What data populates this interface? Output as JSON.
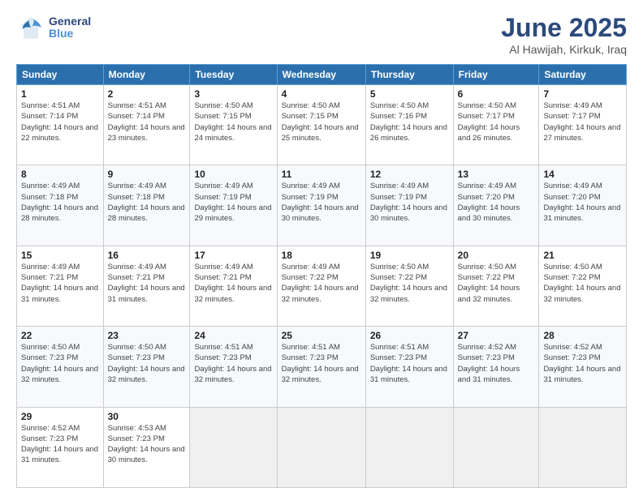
{
  "header": {
    "logo_general": "General",
    "logo_blue": "Blue",
    "month_title": "June 2025",
    "location": "Al Hawijah, Kirkuk, Iraq"
  },
  "weekdays": [
    "Sunday",
    "Monday",
    "Tuesday",
    "Wednesday",
    "Thursday",
    "Friday",
    "Saturday"
  ],
  "weeks": [
    [
      {
        "day": "1",
        "sunrise": "4:51 AM",
        "sunset": "7:14 PM",
        "daylight": "14 hours and 22 minutes."
      },
      {
        "day": "2",
        "sunrise": "4:51 AM",
        "sunset": "7:14 PM",
        "daylight": "14 hours and 23 minutes."
      },
      {
        "day": "3",
        "sunrise": "4:50 AM",
        "sunset": "7:15 PM",
        "daylight": "14 hours and 24 minutes."
      },
      {
        "day": "4",
        "sunrise": "4:50 AM",
        "sunset": "7:15 PM",
        "daylight": "14 hours and 25 minutes."
      },
      {
        "day": "5",
        "sunrise": "4:50 AM",
        "sunset": "7:16 PM",
        "daylight": "14 hours and 26 minutes."
      },
      {
        "day": "6",
        "sunrise": "4:50 AM",
        "sunset": "7:17 PM",
        "daylight": "14 hours and 26 minutes."
      },
      {
        "day": "7",
        "sunrise": "4:49 AM",
        "sunset": "7:17 PM",
        "daylight": "14 hours and 27 minutes."
      }
    ],
    [
      {
        "day": "8",
        "sunrise": "4:49 AM",
        "sunset": "7:18 PM",
        "daylight": "14 hours and 28 minutes."
      },
      {
        "day": "9",
        "sunrise": "4:49 AM",
        "sunset": "7:18 PM",
        "daylight": "14 hours and 28 minutes."
      },
      {
        "day": "10",
        "sunrise": "4:49 AM",
        "sunset": "7:19 PM",
        "daylight": "14 hours and 29 minutes."
      },
      {
        "day": "11",
        "sunrise": "4:49 AM",
        "sunset": "7:19 PM",
        "daylight": "14 hours and 30 minutes."
      },
      {
        "day": "12",
        "sunrise": "4:49 AM",
        "sunset": "7:19 PM",
        "daylight": "14 hours and 30 minutes."
      },
      {
        "day": "13",
        "sunrise": "4:49 AM",
        "sunset": "7:20 PM",
        "daylight": "14 hours and 30 minutes."
      },
      {
        "day": "14",
        "sunrise": "4:49 AM",
        "sunset": "7:20 PM",
        "daylight": "14 hours and 31 minutes."
      }
    ],
    [
      {
        "day": "15",
        "sunrise": "4:49 AM",
        "sunset": "7:21 PM",
        "daylight": "14 hours and 31 minutes."
      },
      {
        "day": "16",
        "sunrise": "4:49 AM",
        "sunset": "7:21 PM",
        "daylight": "14 hours and 31 minutes."
      },
      {
        "day": "17",
        "sunrise": "4:49 AM",
        "sunset": "7:21 PM",
        "daylight": "14 hours and 32 minutes."
      },
      {
        "day": "18",
        "sunrise": "4:49 AM",
        "sunset": "7:22 PM",
        "daylight": "14 hours and 32 minutes."
      },
      {
        "day": "19",
        "sunrise": "4:50 AM",
        "sunset": "7:22 PM",
        "daylight": "14 hours and 32 minutes."
      },
      {
        "day": "20",
        "sunrise": "4:50 AM",
        "sunset": "7:22 PM",
        "daylight": "14 hours and 32 minutes."
      },
      {
        "day": "21",
        "sunrise": "4:50 AM",
        "sunset": "7:22 PM",
        "daylight": "14 hours and 32 minutes."
      }
    ],
    [
      {
        "day": "22",
        "sunrise": "4:50 AM",
        "sunset": "7:23 PM",
        "daylight": "14 hours and 32 minutes."
      },
      {
        "day": "23",
        "sunrise": "4:50 AM",
        "sunset": "7:23 PM",
        "daylight": "14 hours and 32 minutes."
      },
      {
        "day": "24",
        "sunrise": "4:51 AM",
        "sunset": "7:23 PM",
        "daylight": "14 hours and 32 minutes."
      },
      {
        "day": "25",
        "sunrise": "4:51 AM",
        "sunset": "7:23 PM",
        "daylight": "14 hours and 32 minutes."
      },
      {
        "day": "26",
        "sunrise": "4:51 AM",
        "sunset": "7:23 PM",
        "daylight": "14 hours and 31 minutes."
      },
      {
        "day": "27",
        "sunrise": "4:52 AM",
        "sunset": "7:23 PM",
        "daylight": "14 hours and 31 minutes."
      },
      {
        "day": "28",
        "sunrise": "4:52 AM",
        "sunset": "7:23 PM",
        "daylight": "14 hours and 31 minutes."
      }
    ],
    [
      {
        "day": "29",
        "sunrise": "4:52 AM",
        "sunset": "7:23 PM",
        "daylight": "14 hours and 31 minutes."
      },
      {
        "day": "30",
        "sunrise": "4:53 AM",
        "sunset": "7:23 PM",
        "daylight": "14 hours and 30 minutes."
      },
      null,
      null,
      null,
      null,
      null
    ]
  ],
  "labels": {
    "sunrise": "Sunrise:",
    "sunset": "Sunset:",
    "daylight": "Daylight:"
  }
}
